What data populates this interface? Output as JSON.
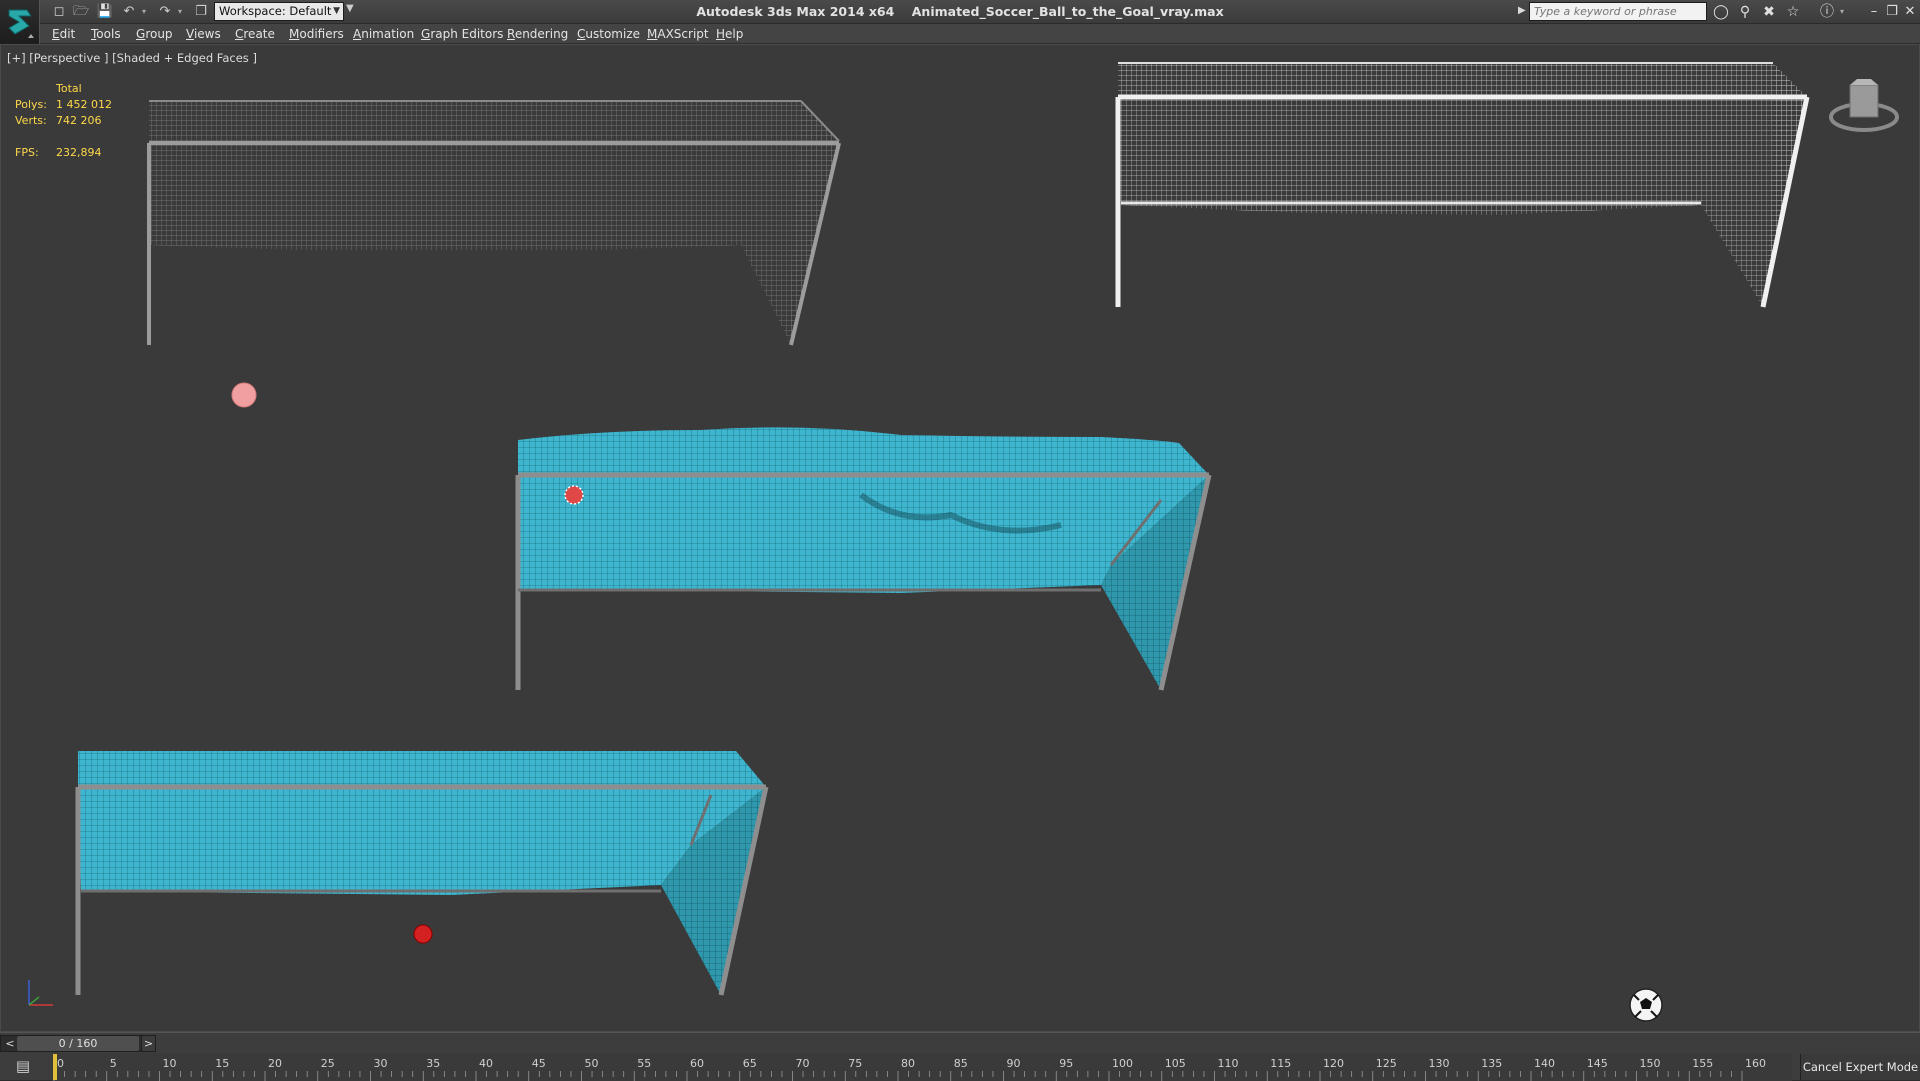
{
  "title_bar": {
    "app_title": "Autodesk 3ds Max  2014 x64",
    "file_name": "Animated_Soccer_Ball_to_the_Goal_vray.max",
    "workspace_label": "Workspace: Default",
    "search_placeholder": "Type a keyword or phrase",
    "icons": [
      "app-logo-icon",
      "new-file-icon",
      "open-file-icon",
      "save-icon",
      "undo-icon",
      "redo-icon",
      "project-folder-icon",
      "binoculars-icon",
      "key-icon",
      "exchange-icon",
      "star-icon",
      "help-icon",
      "minimize-icon",
      "restore-icon",
      "close-icon"
    ]
  },
  "menu": [
    "Edit",
    "Tools",
    "Group",
    "Views",
    "Create",
    "Modifiers",
    "Animation",
    "Graph Editors",
    "Rendering",
    "Customize",
    "MAXScript",
    "Help"
  ],
  "viewport": {
    "label": "[+] [Perspective ] [Shaded + Edged Faces ]",
    "stats": {
      "header": "Total",
      "polys_label": "Polys:",
      "polys_value": "1 452 012",
      "verts_label": "Verts:",
      "verts_value": "742 206",
      "fps_label": "FPS:",
      "fps_value": "232,894"
    },
    "viewcube_icon": "viewcube-icon",
    "axis_icon": "axis-tripod-icon",
    "colors": {
      "background": "#3a3a3a",
      "net_cyan": "#3fb6cf",
      "wire_gray": "#9a9a9a",
      "wire_white": "#e6e6e6",
      "stats_text": "#ffd84a"
    }
  },
  "timeline": {
    "frame_counter": "0 / 160",
    "prev_label": "<",
    "next_label": ">",
    "ticks": [
      "0",
      "5",
      "10",
      "15",
      "20",
      "25",
      "30",
      "35",
      "40",
      "45",
      "50",
      "55",
      "60",
      "65",
      "70",
      "75",
      "80",
      "85",
      "90",
      "95",
      "100",
      "105",
      "110",
      "115",
      "120",
      "125",
      "130",
      "135",
      "140",
      "145",
      "150",
      "155",
      "160"
    ],
    "current_frame": 0,
    "total_frames": 160,
    "cancel_expert": "Cancel Expert Mode"
  }
}
